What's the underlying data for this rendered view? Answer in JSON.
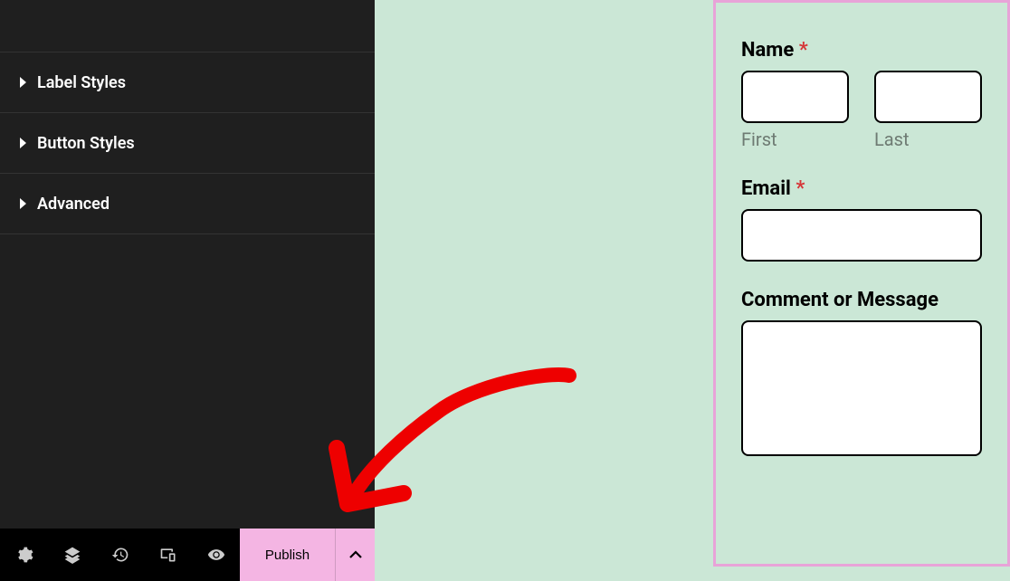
{
  "sidebar": {
    "panels": [
      {
        "label": "Label Styles"
      },
      {
        "label": "Button Styles"
      },
      {
        "label": "Advanced"
      }
    ]
  },
  "bottombar": {
    "publish_label": "Publish"
  },
  "form": {
    "name_label": "Name",
    "name_required": "*",
    "first_sublabel": "First",
    "last_sublabel": "Last",
    "email_label": "Email",
    "email_required": "*",
    "message_label": "Comment or Message"
  },
  "colors": {
    "sidebar_bg": "#1f1f1f",
    "accent_pink": "#f4b5e3",
    "canvas_bg": "#cbe7d6",
    "selection_pink": "#e8a3d8",
    "required_red": "#d63638"
  }
}
